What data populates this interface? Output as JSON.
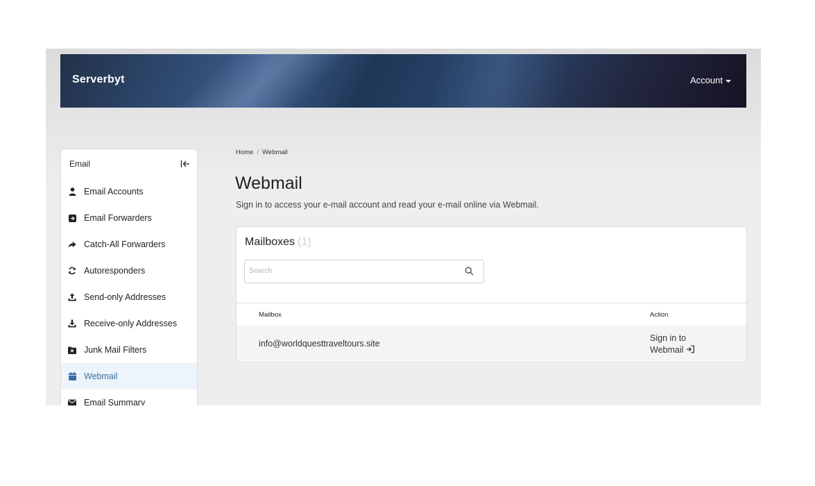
{
  "header": {
    "brand": "Serverbyt",
    "account_label": "Account"
  },
  "sidebar": {
    "title": "Email",
    "items": [
      {
        "label": "Email Accounts",
        "icon": "user-icon"
      },
      {
        "label": "Email Forwarders",
        "icon": "forward-box-icon"
      },
      {
        "label": "Catch-All Forwarders",
        "icon": "share-arrow-icon"
      },
      {
        "label": "Autoresponders",
        "icon": "refresh-icon"
      },
      {
        "label": "Send-only Addresses",
        "icon": "upload-icon"
      },
      {
        "label": "Receive-only Addresses",
        "icon": "download-icon"
      },
      {
        "label": "Junk Mail Filters",
        "icon": "junk-folder-icon"
      },
      {
        "label": "Webmail",
        "icon": "calendar-icon",
        "active": true
      },
      {
        "label": "Email Summary",
        "icon": "envelope-icon"
      }
    ]
  },
  "breadcrumb": {
    "home": "Home",
    "separator": "/",
    "current": "Webmail"
  },
  "page": {
    "title": "Webmail",
    "description": "Sign in to access your e-mail account and read your e-mail online via Webmail."
  },
  "mailboxes": {
    "title": "Mailboxes",
    "count": "(1)",
    "search_placeholder": "Search",
    "columns": {
      "mailbox": "Mailbox",
      "action": "Action"
    },
    "rows": [
      {
        "mailbox": "info@worldquesttraveltours.site",
        "action_line1": "Sign in to",
        "action_line2": "Webmail"
      }
    ]
  },
  "colors": {
    "active_link": "#3a6ea5",
    "active_bg": "#eef4fb",
    "header_dark": "#171225"
  }
}
